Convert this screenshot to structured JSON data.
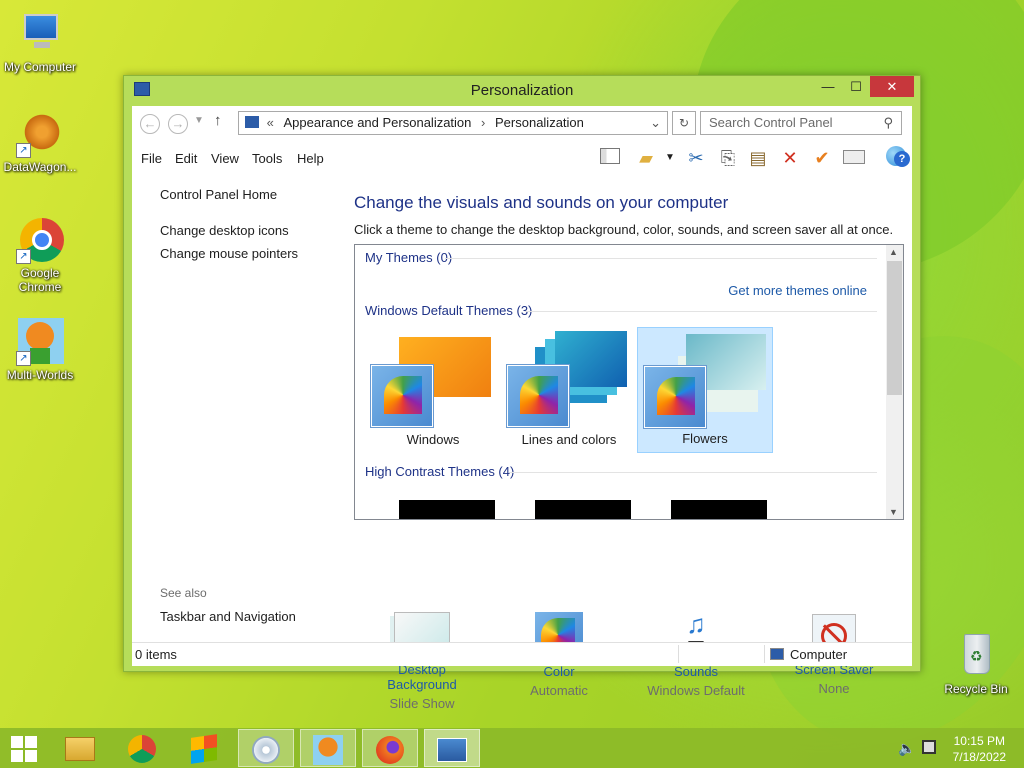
{
  "desktop": {
    "icons": [
      {
        "label": "My Computer"
      },
      {
        "label": "DataWagon..."
      },
      {
        "label": "Google Chrome"
      },
      {
        "label": "Multi-Worlds"
      },
      {
        "label": "Recycle Bin"
      }
    ]
  },
  "window": {
    "title": "Personalization",
    "breadcrumb": [
      "Appearance and Personalization",
      "Personalization"
    ],
    "breadcrumb_prefix": "«",
    "search_placeholder": "Search Control Panel",
    "menu": [
      "File",
      "Edit",
      "View",
      "Tools",
      "Help"
    ],
    "toolbar_icons": [
      "layout-icon",
      "folder-icon",
      "cut-icon",
      "copy-icon",
      "paste-icon",
      "delete-icon",
      "checkmark-icon",
      "properties-icon",
      "globe-icon"
    ],
    "help_icon": "?",
    "left_links": [
      "Control Panel Home",
      "Change desktop icons",
      "Change mouse pointers"
    ],
    "see_also_label": "See also",
    "see_also_links": [
      "Taskbar and Navigation"
    ],
    "heading": "Change the visuals and sounds on your computer",
    "subheading": "Click a theme to change the desktop background, color, sounds, and screen saver all at once.",
    "themes_panel": {
      "my_themes": "My Themes (0)",
      "get_more": "Get more themes online",
      "default_group": "Windows Default Themes (3)",
      "themes": [
        {
          "name": "Windows",
          "selected": false
        },
        {
          "name": "Lines and colors",
          "selected": false
        },
        {
          "name": "Flowers",
          "selected": true
        }
      ],
      "high_contrast_group": "High Contrast Themes (4)"
    },
    "bottom_items": [
      {
        "link": "Desktop Background",
        "value": "Slide Show"
      },
      {
        "link": "Color",
        "value": "Automatic"
      },
      {
        "link": "Sounds",
        "value": "Windows Default"
      },
      {
        "link": "Screen Saver",
        "value": "None"
      }
    ],
    "status_left": "0 items",
    "status_right": "Computer"
  },
  "taskbar": {
    "time": "10:15 PM",
    "date": "7/18/2022"
  },
  "colors": {
    "accent": "#b6dd5a",
    "link": "#1e5aa8",
    "heading": "#1e3287",
    "close": "#c7373c"
  }
}
